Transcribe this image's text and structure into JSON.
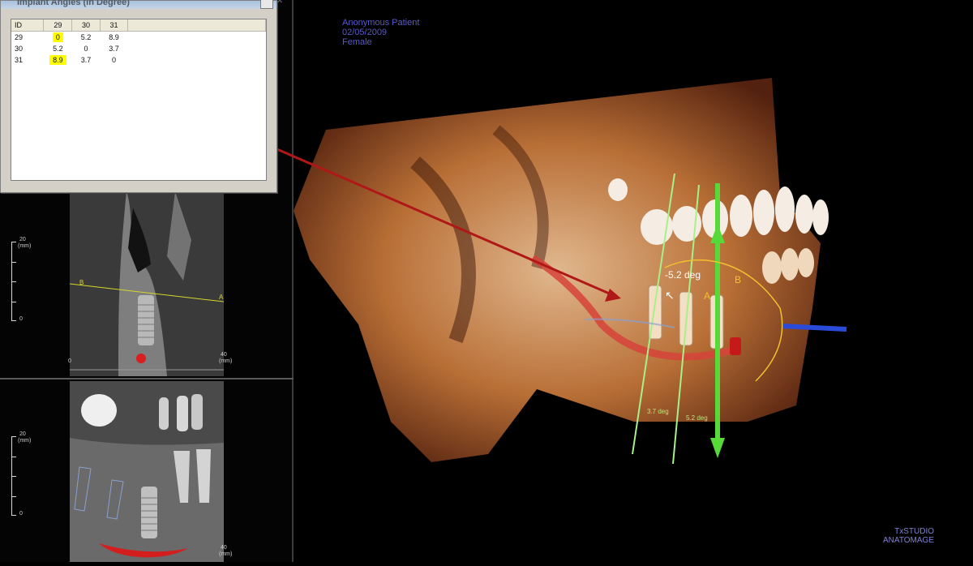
{
  "dialog": {
    "title": "Implant Angles (in Degree)",
    "close_label": "x",
    "columns": [
      "ID",
      "29",
      "30",
      "31"
    ],
    "rows": [
      [
        "29",
        "0",
        "5.2",
        "8.9"
      ],
      [
        "30",
        "5.2",
        "0",
        "3.7"
      ],
      [
        "31",
        "8.9",
        "3.7",
        "0"
      ]
    ]
  },
  "patient": {
    "name": "Anonymous Patient",
    "date": "02/05/2009",
    "sex": "Female"
  },
  "viewer": {
    "angle_main": "-5.2 deg",
    "label_a": "A",
    "label_b": "B",
    "angle_37": "3.7 deg",
    "angle_52": "5.2 deg"
  },
  "slice_top": {
    "ruler_top": "20",
    "ruler_unit": "(mm)",
    "ruler_zero": "0",
    "axis_start": "0",
    "axis_end": "40",
    "axis_unit": "(mm)",
    "line_b": "B",
    "line_a": "A"
  },
  "slice_bottom": {
    "ruler_top": "20",
    "ruler_unit": "(mm)",
    "ruler_zero": "0",
    "axis_end": "40",
    "axis_unit": "(mm)"
  },
  "brand": {
    "line1": "TxSTUDIO",
    "line2": "ANATOMAGE"
  },
  "colors": {
    "highlight": "#ffff00",
    "arrow": "#b01818",
    "axis_green": "#57d93a",
    "axis_blue": "#2a4bd8",
    "label_text": "#5959c8"
  }
}
